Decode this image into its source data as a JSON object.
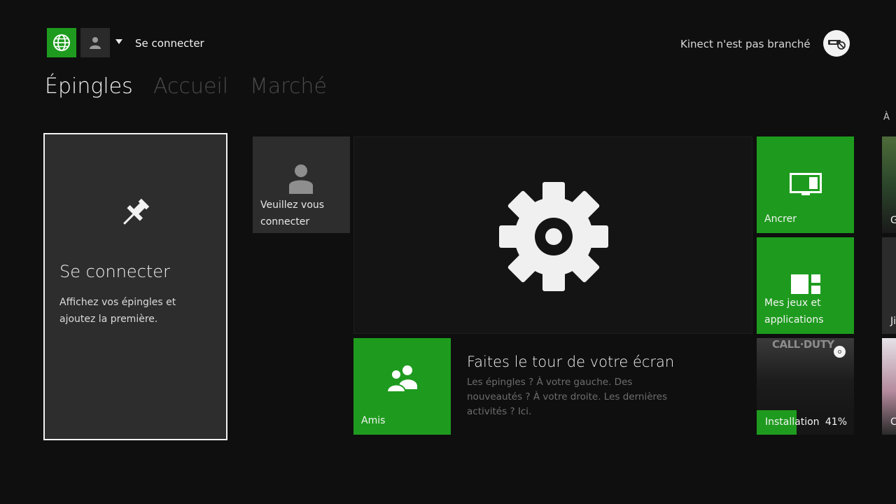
{
  "topbar": {
    "signin_label": "Se connecter",
    "kinect_status": "Kinect n'est pas branché",
    "globe_icon": "globe-icon",
    "user_icon": "person-icon",
    "kinect_icon": "kinect-disconnected-icon"
  },
  "tabs": [
    {
      "label": "Épingles",
      "active": true
    },
    {
      "label": "Accueil",
      "active": false
    },
    {
      "label": "Marché",
      "active": false
    }
  ],
  "side_header": "À L",
  "pins": {
    "title": "Se connecter",
    "description": "Affichez vos épingles et ajoutez la première.",
    "icon": "pin-icon"
  },
  "profile_tile": {
    "label": "Veuillez vous connecter",
    "icon": "person-icon"
  },
  "settings_tile": {
    "icon": "gear-icon"
  },
  "anchor_tile": {
    "label": "Ancrer",
    "icon": "monitor-icon"
  },
  "games_tile": {
    "label": "Mes jeux et applications",
    "icon": "apps-grid-icon"
  },
  "friends_tile": {
    "label": "Amis",
    "icon": "friends-icon"
  },
  "tour": {
    "title": "Faites le tour de votre écran",
    "description": "Les épingles ? À votre gauche. Des nouveautés ? À votre droite. Les dernières activités ? Ici."
  },
  "install_tile": {
    "art_title": "CALL·DUTY",
    "label": "Installation",
    "percent_text": "41%",
    "progress": 0.41,
    "queue_badge": "o"
  },
  "peek_tiles": [
    {
      "label": "G"
    },
    {
      "label": "Ji"
    },
    {
      "label": "C"
    }
  ],
  "colors": {
    "accent_green": "#1e9b1e",
    "background": "#0f0f0f",
    "tile_dark": "#2d2d2d"
  }
}
